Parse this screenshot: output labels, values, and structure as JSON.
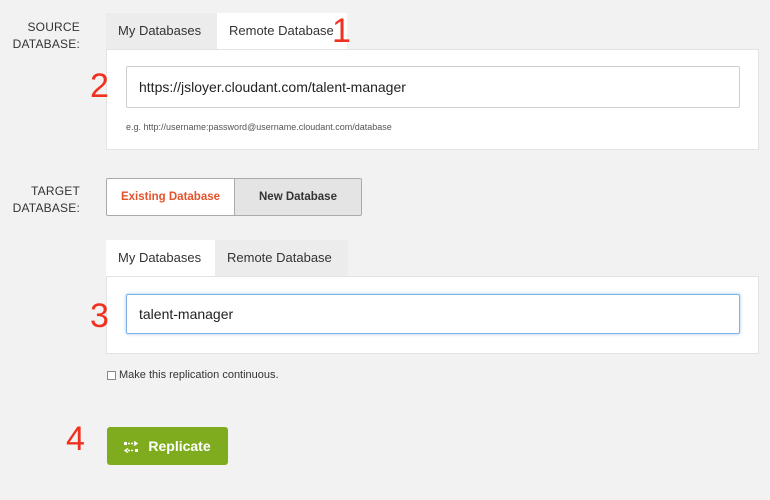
{
  "source": {
    "label_line1": "SOURCE",
    "label_line2": "DATABASE:",
    "tabs": [
      "My Databases",
      "Remote Database"
    ],
    "active_tab": "Remote Database",
    "url_value": "https://jsloyer.cloudant.com/talent-manager",
    "hint": "e.g. http://username:password@username.cloudant.com/database"
  },
  "target": {
    "label_line1": "TARGET",
    "label_line2": "DATABASE:",
    "toggle": [
      "Existing Database",
      "New Database"
    ],
    "toggle_selected": "Existing Database",
    "tabs": [
      "My Databases",
      "Remote Database"
    ],
    "active_tab": "My Databases",
    "db_value": "talent-manager"
  },
  "continuous_label": "Make this replication continuous.",
  "continuous_checked": false,
  "replicate_label": "Replicate",
  "annotations": [
    "1",
    "2",
    "3",
    "4"
  ],
  "colors": {
    "accent_orange": "#e5532c",
    "replicate_green": "#7fac1f",
    "annotation_red": "#f0311f"
  },
  "icons": {
    "replicate": "replicate-arrows-icon",
    "checkbox": "checkbox-icon"
  }
}
